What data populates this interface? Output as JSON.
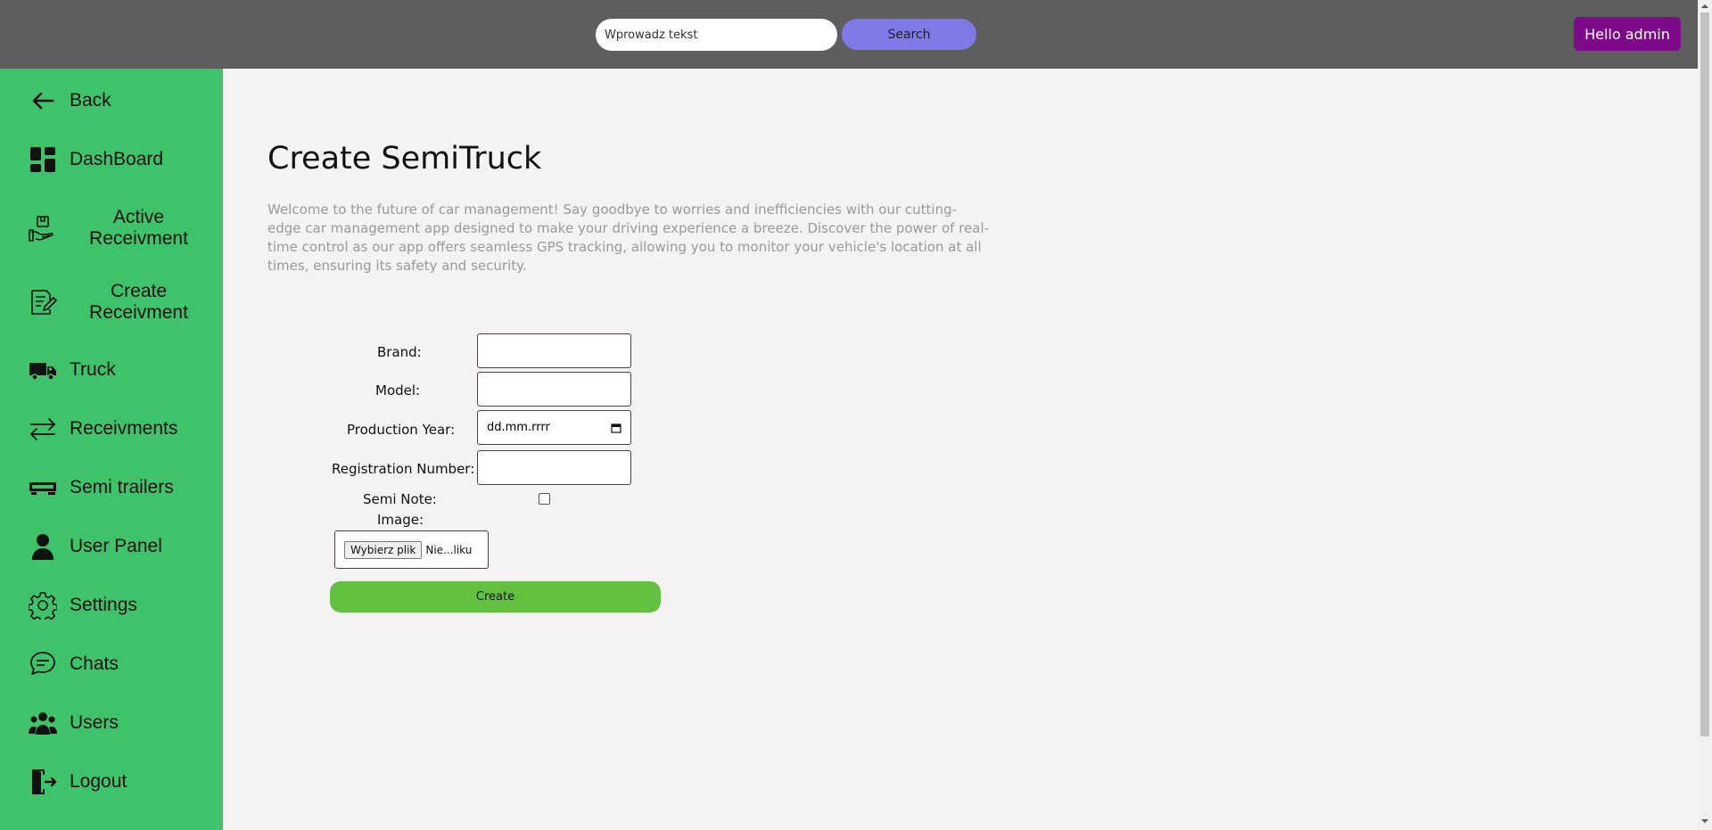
{
  "topbar": {
    "search_placeholder": "Wprowadz tekst",
    "search_label": "Search",
    "greeting": "Hello admin"
  },
  "sidebar": {
    "items": [
      {
        "label": "Back",
        "icon": "arrow-left-icon"
      },
      {
        "label": "DashBoard",
        "icon": "dashboard-icon"
      },
      {
        "label": "Active Receivment",
        "icon": "hand-package-icon"
      },
      {
        "label": "Create Receivment",
        "icon": "document-edit-icon"
      },
      {
        "label": "Truck",
        "icon": "truck-icon"
      },
      {
        "label": "Receivments",
        "icon": "arrows-exchange-icon"
      },
      {
        "label": "Semi trailers",
        "icon": "trailer-icon"
      },
      {
        "label": "User Panel",
        "icon": "user-icon"
      },
      {
        "label": "Settings",
        "icon": "gear-icon"
      },
      {
        "label": "Chats",
        "icon": "chat-icon"
      },
      {
        "label": "Users",
        "icon": "users-icon"
      },
      {
        "label": "Logout",
        "icon": "logout-icon"
      }
    ]
  },
  "main": {
    "title": "Create SemiTruck",
    "intro": "Welcome to the future of car management! Say goodbye to worries and inefficiencies with our cutting-edge car management app designed to make your driving experience a breeze. Discover the power of real-time control as our app offers seamless GPS tracking, allowing you to monitor your vehicle's location at all times, ensuring its safety and security."
  },
  "form": {
    "brand_label": "Brand:",
    "brand_value": "",
    "model_label": "Model:",
    "model_value": "",
    "year_label": "Production Year:",
    "year_placeholder": "dd.mm.rrrr",
    "registration_label": "Registration Number:",
    "registration_value": "",
    "semi_note_label": "Semi Note:",
    "semi_note_checked": false,
    "image_label": "Image:",
    "file_button": "Wybierz plik",
    "file_name": "Nie...liku",
    "create_label": "Create"
  },
  "colors": {
    "topbar": "#5e5e5e",
    "sidebar": "#3ec36a",
    "search_button": "#7d7ae8",
    "greeting_button": "#7d0a89",
    "create_button": "#62c13e",
    "background": "#f4f2f2"
  }
}
